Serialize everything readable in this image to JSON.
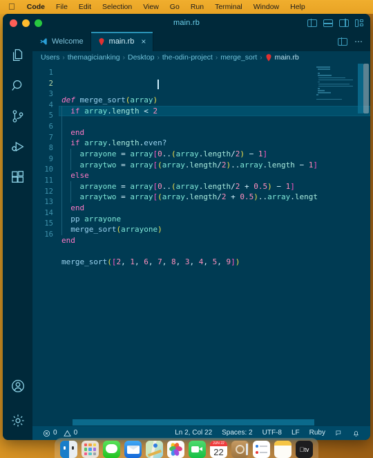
{
  "menubar": {
    "apple_logo": "",
    "items": [
      {
        "label": "Code",
        "bold": true
      },
      {
        "label": "File",
        "bold": false
      },
      {
        "label": "Edit",
        "bold": false
      },
      {
        "label": "Selection",
        "bold": false
      },
      {
        "label": "View",
        "bold": false
      },
      {
        "label": "Go",
        "bold": false
      },
      {
        "label": "Run",
        "bold": false
      },
      {
        "label": "Terminal",
        "bold": false
      },
      {
        "label": "Window",
        "bold": false
      },
      {
        "label": "Help",
        "bold": false
      }
    ]
  },
  "window": {
    "title": "main.rb",
    "traffic_lights": [
      "close",
      "minimize",
      "zoom"
    ],
    "layout_buttons": [
      "toggle-primary-sidebar",
      "toggle-panel",
      "toggle-secondary-sidebar",
      "customize-layout"
    ]
  },
  "activity_bar": {
    "items": [
      {
        "name": "explorer",
        "icon": "files-icon"
      },
      {
        "name": "search",
        "icon": "search-icon"
      },
      {
        "name": "source-control",
        "icon": "source-control-icon"
      },
      {
        "name": "run-and-debug",
        "icon": "run-debug-icon"
      },
      {
        "name": "extensions",
        "icon": "extensions-icon"
      }
    ],
    "bottom_items": [
      {
        "name": "accounts",
        "icon": "account-icon"
      },
      {
        "name": "manage-settings",
        "icon": "gear-icon"
      }
    ]
  },
  "tabs": [
    {
      "label": "Welcome",
      "icon": "vscode-logo-icon",
      "active": false,
      "closable": false
    },
    {
      "label": "main.rb",
      "icon": "ruby-icon",
      "active": true,
      "closable": true,
      "close_label": "×"
    }
  ],
  "tab_actions": {
    "split_editor": "split-editor-icon",
    "more_actions": "⋯"
  },
  "breadcrumbs": {
    "separator": "›",
    "items": [
      "Users",
      "themagicianking",
      "Desktop",
      "the-odin-project",
      "merge_sort",
      "main.rb"
    ],
    "file_icon": "ruby-icon"
  },
  "editor": {
    "language": "Ruby",
    "cursor_line": 2,
    "lines": [
      {
        "n": 1,
        "indent": 0,
        "tokens": [
          {
            "t": "def",
            "c": "t-kw"
          },
          {
            "t": " ",
            "c": "t-plain"
          },
          {
            "t": "merge_sort",
            "c": "t-fn"
          },
          {
            "t": "(",
            "c": "t-br2"
          },
          {
            "t": "array",
            "c": "t-var"
          },
          {
            "t": ")",
            "c": "t-br2"
          }
        ]
      },
      {
        "n": 2,
        "indent": 1,
        "highlight": true,
        "tokens": [
          {
            "t": "  ",
            "c": "t-plain"
          },
          {
            "t": "if",
            "c": "t-kw2"
          },
          {
            "t": " ",
            "c": "t-plain"
          },
          {
            "t": "array",
            "c": "t-var"
          },
          {
            "t": ".",
            "c": "t-plain"
          },
          {
            "t": "length",
            "c": "t-prop"
          },
          {
            "t": " ",
            "c": "t-plain"
          },
          {
            "t": "<",
            "c": "t-op"
          },
          {
            "t": " ",
            "c": "t-plain"
          },
          {
            "t": "2",
            "c": "t-num"
          }
        ]
      },
      {
        "n": 3,
        "indent": 1,
        "tokens": []
      },
      {
        "n": 4,
        "indent": 1,
        "tokens": [
          {
            "t": "  ",
            "c": "t-plain"
          },
          {
            "t": "end",
            "c": "t-kw2"
          }
        ]
      },
      {
        "n": 5,
        "indent": 1,
        "tokens": [
          {
            "t": "  ",
            "c": "t-plain"
          },
          {
            "t": "if",
            "c": "t-kw2"
          },
          {
            "t": " ",
            "c": "t-plain"
          },
          {
            "t": "array",
            "c": "t-var"
          },
          {
            "t": ".",
            "c": "t-plain"
          },
          {
            "t": "length",
            "c": "t-prop"
          },
          {
            "t": ".",
            "c": "t-plain"
          },
          {
            "t": "even?",
            "c": "t-meth"
          }
        ]
      },
      {
        "n": 6,
        "indent": 2,
        "tokens": [
          {
            "t": "    ",
            "c": "t-plain"
          },
          {
            "t": "arrayone",
            "c": "t-var"
          },
          {
            "t": " ",
            "c": "t-plain"
          },
          {
            "t": "=",
            "c": "t-op"
          },
          {
            "t": " ",
            "c": "t-plain"
          },
          {
            "t": "array",
            "c": "t-var"
          },
          {
            "t": "[",
            "c": "t-br1"
          },
          {
            "t": "0",
            "c": "t-num"
          },
          {
            "t": "..",
            "c": "t-plain"
          },
          {
            "t": "(",
            "c": "t-br2"
          },
          {
            "t": "array",
            "c": "t-var"
          },
          {
            "t": ".",
            "c": "t-plain"
          },
          {
            "t": "length",
            "c": "t-prop"
          },
          {
            "t": "/",
            "c": "t-op"
          },
          {
            "t": "2",
            "c": "t-num"
          },
          {
            "t": ")",
            "c": "t-br2"
          },
          {
            "t": " ",
            "c": "t-plain"
          },
          {
            "t": "−",
            "c": "t-op"
          },
          {
            "t": " ",
            "c": "t-plain"
          },
          {
            "t": "1",
            "c": "t-num"
          },
          {
            "t": "]",
            "c": "t-br1"
          }
        ]
      },
      {
        "n": 7,
        "indent": 2,
        "tokens": [
          {
            "t": "    ",
            "c": "t-plain"
          },
          {
            "t": "arraytwo",
            "c": "t-var"
          },
          {
            "t": " ",
            "c": "t-plain"
          },
          {
            "t": "=",
            "c": "t-op"
          },
          {
            "t": " ",
            "c": "t-plain"
          },
          {
            "t": "array",
            "c": "t-var"
          },
          {
            "t": "[",
            "c": "t-br1"
          },
          {
            "t": "(",
            "c": "t-br2"
          },
          {
            "t": "array",
            "c": "t-var"
          },
          {
            "t": ".",
            "c": "t-plain"
          },
          {
            "t": "length",
            "c": "t-prop"
          },
          {
            "t": "/",
            "c": "t-op"
          },
          {
            "t": "2",
            "c": "t-num"
          },
          {
            "t": ")",
            "c": "t-br2"
          },
          {
            "t": "..",
            "c": "t-plain"
          },
          {
            "t": "array",
            "c": "t-var"
          },
          {
            "t": ".",
            "c": "t-plain"
          },
          {
            "t": "length",
            "c": "t-prop"
          },
          {
            "t": " ",
            "c": "t-plain"
          },
          {
            "t": "−",
            "c": "t-op"
          },
          {
            "t": " ",
            "c": "t-plain"
          },
          {
            "t": "1",
            "c": "t-num"
          },
          {
            "t": "]",
            "c": "t-br1"
          }
        ]
      },
      {
        "n": 8,
        "indent": 1,
        "tokens": [
          {
            "t": "  ",
            "c": "t-plain"
          },
          {
            "t": "else",
            "c": "t-kw2"
          }
        ]
      },
      {
        "n": 9,
        "indent": 2,
        "tokens": [
          {
            "t": "    ",
            "c": "t-plain"
          },
          {
            "t": "arrayone",
            "c": "t-var"
          },
          {
            "t": " ",
            "c": "t-plain"
          },
          {
            "t": "=",
            "c": "t-op"
          },
          {
            "t": " ",
            "c": "t-plain"
          },
          {
            "t": "array",
            "c": "t-var"
          },
          {
            "t": "[",
            "c": "t-br1"
          },
          {
            "t": "0",
            "c": "t-num"
          },
          {
            "t": "..",
            "c": "t-plain"
          },
          {
            "t": "(",
            "c": "t-br2"
          },
          {
            "t": "array",
            "c": "t-var"
          },
          {
            "t": ".",
            "c": "t-plain"
          },
          {
            "t": "length",
            "c": "t-prop"
          },
          {
            "t": "/",
            "c": "t-op"
          },
          {
            "t": "2",
            "c": "t-num"
          },
          {
            "t": " ",
            "c": "t-plain"
          },
          {
            "t": "+",
            "c": "t-op"
          },
          {
            "t": " ",
            "c": "t-plain"
          },
          {
            "t": "0.5",
            "c": "t-num"
          },
          {
            "t": ")",
            "c": "t-br2"
          },
          {
            "t": " ",
            "c": "t-plain"
          },
          {
            "t": "−",
            "c": "t-op"
          },
          {
            "t": " ",
            "c": "t-plain"
          },
          {
            "t": "1",
            "c": "t-num"
          },
          {
            "t": "]",
            "c": "t-br1"
          }
        ]
      },
      {
        "n": 10,
        "indent": 2,
        "tokens": [
          {
            "t": "    ",
            "c": "t-plain"
          },
          {
            "t": "arraytwo",
            "c": "t-var"
          },
          {
            "t": " ",
            "c": "t-plain"
          },
          {
            "t": "=",
            "c": "t-op"
          },
          {
            "t": " ",
            "c": "t-plain"
          },
          {
            "t": "array",
            "c": "t-var"
          },
          {
            "t": "[",
            "c": "t-br1"
          },
          {
            "t": "(",
            "c": "t-br2"
          },
          {
            "t": "array",
            "c": "t-var"
          },
          {
            "t": ".",
            "c": "t-plain"
          },
          {
            "t": "length",
            "c": "t-prop"
          },
          {
            "t": "/",
            "c": "t-op"
          },
          {
            "t": "2",
            "c": "t-num"
          },
          {
            "t": " ",
            "c": "t-plain"
          },
          {
            "t": "+",
            "c": "t-op"
          },
          {
            "t": " ",
            "c": "t-plain"
          },
          {
            "t": "0.5",
            "c": "t-num"
          },
          {
            "t": ")",
            "c": "t-br2"
          },
          {
            "t": "..",
            "c": "t-plain"
          },
          {
            "t": "array",
            "c": "t-var"
          },
          {
            "t": ".",
            "c": "t-plain"
          },
          {
            "t": "lengt",
            "c": "t-prop"
          }
        ]
      },
      {
        "n": 11,
        "indent": 1,
        "tokens": [
          {
            "t": "  ",
            "c": "t-plain"
          },
          {
            "t": "end",
            "c": "t-kw2"
          }
        ]
      },
      {
        "n": 12,
        "indent": 1,
        "tokens": [
          {
            "t": "  ",
            "c": "t-plain"
          },
          {
            "t": "pp",
            "c": "t-meth"
          },
          {
            "t": " ",
            "c": "t-plain"
          },
          {
            "t": "arrayone",
            "c": "t-var"
          }
        ]
      },
      {
        "n": 13,
        "indent": 1,
        "tokens": [
          {
            "t": "  ",
            "c": "t-plain"
          },
          {
            "t": "merge_sort",
            "c": "t-fn"
          },
          {
            "t": "(",
            "c": "t-br2"
          },
          {
            "t": "arrayone",
            "c": "t-var"
          },
          {
            "t": ")",
            "c": "t-br2"
          }
        ]
      },
      {
        "n": 14,
        "indent": 0,
        "tokens": [
          {
            "t": "end",
            "c": "t-kw2"
          }
        ]
      },
      {
        "n": 15,
        "indent": 0,
        "tokens": []
      },
      {
        "n": 16,
        "indent": 0,
        "tokens": [
          {
            "t": "merge_sort",
            "c": "t-fn"
          },
          {
            "t": "(",
            "c": "t-br2"
          },
          {
            "t": "[",
            "c": "t-br1"
          },
          {
            "t": "2",
            "c": "t-num"
          },
          {
            "t": ", ",
            "c": "t-plain"
          },
          {
            "t": "1",
            "c": "t-num"
          },
          {
            "t": ", ",
            "c": "t-plain"
          },
          {
            "t": "6",
            "c": "t-num"
          },
          {
            "t": ", ",
            "c": "t-plain"
          },
          {
            "t": "7",
            "c": "t-num"
          },
          {
            "t": ", ",
            "c": "t-plain"
          },
          {
            "t": "8",
            "c": "t-num"
          },
          {
            "t": ", ",
            "c": "t-plain"
          },
          {
            "t": "3",
            "c": "t-num"
          },
          {
            "t": ", ",
            "c": "t-plain"
          },
          {
            "t": "4",
            "c": "t-num"
          },
          {
            "t": ", ",
            "c": "t-plain"
          },
          {
            "t": "5",
            "c": "t-num"
          },
          {
            "t": ", ",
            "c": "t-plain"
          },
          {
            "t": "9",
            "c": "t-num"
          },
          {
            "t": "]",
            "c": "t-br1"
          },
          {
            "t": ")",
            "c": "t-br2"
          }
        ]
      }
    ]
  },
  "status_bar": {
    "errors": "0",
    "warnings": "0",
    "error_icon": "error-circle-icon",
    "warning_icon": "warning-triangle-icon",
    "cursor_position": "Ln 2, Col 22",
    "indentation": "Spaces: 2",
    "encoding": "UTF-8",
    "eol": "LF",
    "language_mode": "Ruby",
    "feedback_icon": "remote-icon",
    "notifications_icon": "bell-icon"
  },
  "dock": {
    "items": [
      {
        "name": "finder",
        "label": ""
      },
      {
        "name": "launchpad",
        "label": ""
      },
      {
        "name": "messages",
        "label": ""
      },
      {
        "name": "mail",
        "label": ""
      },
      {
        "name": "maps",
        "label": ""
      },
      {
        "name": "photos",
        "label": ""
      },
      {
        "name": "facetime",
        "label": ""
      },
      {
        "name": "calendar",
        "label": "JUN 22"
      },
      {
        "name": "contacts",
        "label": ""
      },
      {
        "name": "reminders",
        "label": ""
      },
      {
        "name": "notes",
        "label": ""
      },
      {
        "name": "apple-tv",
        "label": "tv"
      }
    ]
  },
  "colors": {
    "desktop": "#d79224",
    "menubar": "#eda72a",
    "editor_bg": "#003b53",
    "chrome_bg": "#00293a",
    "status_bg": "#004a68",
    "accent": "#2a93b6",
    "tab_active_border": "#2a93b6",
    "ruby_red": "#e03131"
  }
}
